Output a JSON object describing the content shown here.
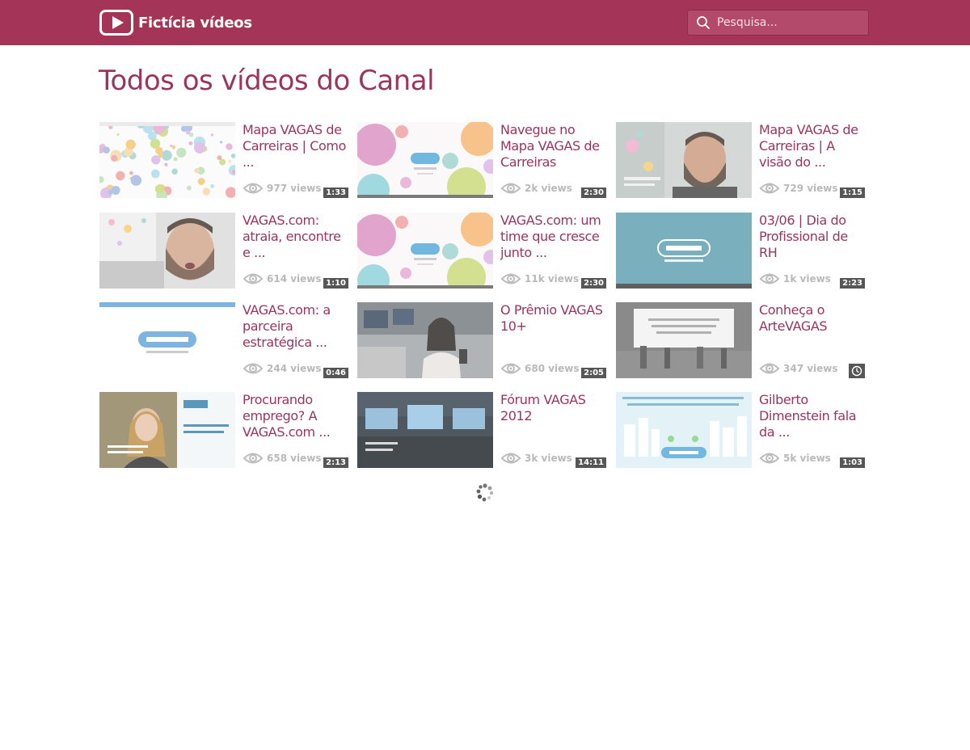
{
  "header": {
    "logo_text": "Fictícia vídeos",
    "search_placeholder": "Pesquisa..."
  },
  "page": {
    "title": "Todos os vídeos do Canal"
  },
  "colors": {
    "brand": "#a43558",
    "title": "#9a3560",
    "muted": "#b9b9b9"
  },
  "videos": [
    {
      "title": "Mapa VAGAS de Carreiras | Como ...",
      "duration": "1:33",
      "views": "977 views",
      "thumb": "bubbles-white"
    },
    {
      "title": "Navegue no Mapa VAGAS de Carreiras",
      "duration": "2:30",
      "views": "2k views",
      "thumb": "bubbles-logo"
    },
    {
      "title": "Mapa VAGAS de Carreiras | A visão do ...",
      "duration": "1:15",
      "views": "729 views",
      "thumb": "person-beard"
    },
    {
      "title": "VAGAS.com: atraia, encontre e ...",
      "duration": "1:10",
      "views": "614 views",
      "thumb": "person-talking"
    },
    {
      "title": "VAGAS.com: um time que cresce junto ...",
      "duration": "2:30",
      "views": "11k views",
      "thumb": "bubbles-logo"
    },
    {
      "title": "03/06 | Dia do Profissional de RH",
      "duration": "2:23",
      "views": "1k views",
      "thumb": "blue-logo"
    },
    {
      "title": "VAGAS.com: a parceira estratégica ...",
      "duration": "0:46",
      "views": "244 views",
      "thumb": "white-logo"
    },
    {
      "title": "O Prêmio VAGAS 10+",
      "duration": "2:05",
      "views": "680 views",
      "thumb": "reporter"
    },
    {
      "title": "Conheça o ArteVAGAS",
      "duration": "",
      "views": "347 views",
      "thumb": "gallery"
    },
    {
      "title": "Procurando emprego? A VAGAS.com ...",
      "duration": "2:13",
      "views": "658 views",
      "thumb": "woman-banner"
    },
    {
      "title": "Fórum VAGAS 2012",
      "duration": "14:11",
      "views": "3k views",
      "thumb": "stage"
    },
    {
      "title": "Gilberto Dimenstein fala da ...",
      "duration": "1:03",
      "views": "5k views",
      "thumb": "city-logo"
    }
  ]
}
